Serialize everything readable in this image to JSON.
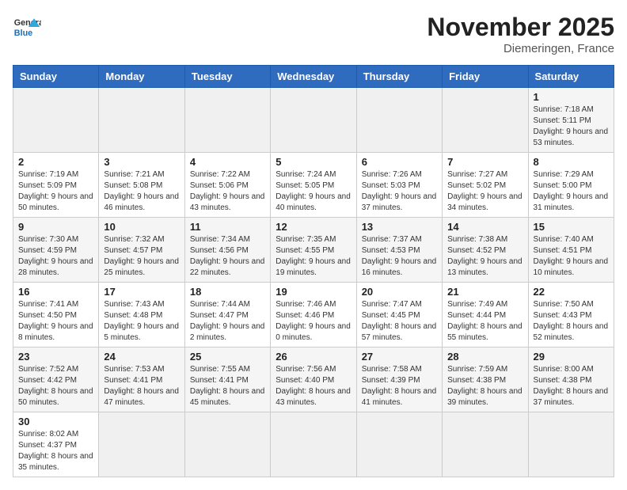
{
  "header": {
    "logo_general": "General",
    "logo_blue": "Blue",
    "title": "November 2025",
    "subtitle": "Diemeringen, France"
  },
  "weekdays": [
    "Sunday",
    "Monday",
    "Tuesday",
    "Wednesday",
    "Thursday",
    "Friday",
    "Saturday"
  ],
  "weeks": [
    [
      {
        "day": "",
        "info": ""
      },
      {
        "day": "",
        "info": ""
      },
      {
        "day": "",
        "info": ""
      },
      {
        "day": "",
        "info": ""
      },
      {
        "day": "",
        "info": ""
      },
      {
        "day": "",
        "info": ""
      },
      {
        "day": "1",
        "info": "Sunrise: 7:18 AM\nSunset: 5:11 PM\nDaylight: 9 hours and 53 minutes."
      }
    ],
    [
      {
        "day": "2",
        "info": "Sunrise: 7:19 AM\nSunset: 5:09 PM\nDaylight: 9 hours and 50 minutes."
      },
      {
        "day": "3",
        "info": "Sunrise: 7:21 AM\nSunset: 5:08 PM\nDaylight: 9 hours and 46 minutes."
      },
      {
        "day": "4",
        "info": "Sunrise: 7:22 AM\nSunset: 5:06 PM\nDaylight: 9 hours and 43 minutes."
      },
      {
        "day": "5",
        "info": "Sunrise: 7:24 AM\nSunset: 5:05 PM\nDaylight: 9 hours and 40 minutes."
      },
      {
        "day": "6",
        "info": "Sunrise: 7:26 AM\nSunset: 5:03 PM\nDaylight: 9 hours and 37 minutes."
      },
      {
        "day": "7",
        "info": "Sunrise: 7:27 AM\nSunset: 5:02 PM\nDaylight: 9 hours and 34 minutes."
      },
      {
        "day": "8",
        "info": "Sunrise: 7:29 AM\nSunset: 5:00 PM\nDaylight: 9 hours and 31 minutes."
      }
    ],
    [
      {
        "day": "9",
        "info": "Sunrise: 7:30 AM\nSunset: 4:59 PM\nDaylight: 9 hours and 28 minutes."
      },
      {
        "day": "10",
        "info": "Sunrise: 7:32 AM\nSunset: 4:57 PM\nDaylight: 9 hours and 25 minutes."
      },
      {
        "day": "11",
        "info": "Sunrise: 7:34 AM\nSunset: 4:56 PM\nDaylight: 9 hours and 22 minutes."
      },
      {
        "day": "12",
        "info": "Sunrise: 7:35 AM\nSunset: 4:55 PM\nDaylight: 9 hours and 19 minutes."
      },
      {
        "day": "13",
        "info": "Sunrise: 7:37 AM\nSunset: 4:53 PM\nDaylight: 9 hours and 16 minutes."
      },
      {
        "day": "14",
        "info": "Sunrise: 7:38 AM\nSunset: 4:52 PM\nDaylight: 9 hours and 13 minutes."
      },
      {
        "day": "15",
        "info": "Sunrise: 7:40 AM\nSunset: 4:51 PM\nDaylight: 9 hours and 10 minutes."
      }
    ],
    [
      {
        "day": "16",
        "info": "Sunrise: 7:41 AM\nSunset: 4:50 PM\nDaylight: 9 hours and 8 minutes."
      },
      {
        "day": "17",
        "info": "Sunrise: 7:43 AM\nSunset: 4:48 PM\nDaylight: 9 hours and 5 minutes."
      },
      {
        "day": "18",
        "info": "Sunrise: 7:44 AM\nSunset: 4:47 PM\nDaylight: 9 hours and 2 minutes."
      },
      {
        "day": "19",
        "info": "Sunrise: 7:46 AM\nSunset: 4:46 PM\nDaylight: 9 hours and 0 minutes."
      },
      {
        "day": "20",
        "info": "Sunrise: 7:47 AM\nSunset: 4:45 PM\nDaylight: 8 hours and 57 minutes."
      },
      {
        "day": "21",
        "info": "Sunrise: 7:49 AM\nSunset: 4:44 PM\nDaylight: 8 hours and 55 minutes."
      },
      {
        "day": "22",
        "info": "Sunrise: 7:50 AM\nSunset: 4:43 PM\nDaylight: 8 hours and 52 minutes."
      }
    ],
    [
      {
        "day": "23",
        "info": "Sunrise: 7:52 AM\nSunset: 4:42 PM\nDaylight: 8 hours and 50 minutes."
      },
      {
        "day": "24",
        "info": "Sunrise: 7:53 AM\nSunset: 4:41 PM\nDaylight: 8 hours and 47 minutes."
      },
      {
        "day": "25",
        "info": "Sunrise: 7:55 AM\nSunset: 4:41 PM\nDaylight: 8 hours and 45 minutes."
      },
      {
        "day": "26",
        "info": "Sunrise: 7:56 AM\nSunset: 4:40 PM\nDaylight: 8 hours and 43 minutes."
      },
      {
        "day": "27",
        "info": "Sunrise: 7:58 AM\nSunset: 4:39 PM\nDaylight: 8 hours and 41 minutes."
      },
      {
        "day": "28",
        "info": "Sunrise: 7:59 AM\nSunset: 4:38 PM\nDaylight: 8 hours and 39 minutes."
      },
      {
        "day": "29",
        "info": "Sunrise: 8:00 AM\nSunset: 4:38 PM\nDaylight: 8 hours and 37 minutes."
      }
    ],
    [
      {
        "day": "30",
        "info": "Sunrise: 8:02 AM\nSunset: 4:37 PM\nDaylight: 8 hours and 35 minutes."
      },
      {
        "day": "",
        "info": ""
      },
      {
        "day": "",
        "info": ""
      },
      {
        "day": "",
        "info": ""
      },
      {
        "day": "",
        "info": ""
      },
      {
        "day": "",
        "info": ""
      },
      {
        "day": "",
        "info": ""
      }
    ]
  ]
}
